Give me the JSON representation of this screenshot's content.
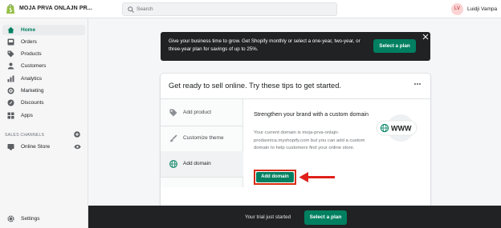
{
  "store": {
    "name": "MOJA PRVA ONLAJN PR..."
  },
  "search": {
    "placeholder": "Search"
  },
  "user": {
    "initials": "LV",
    "name": "Luidji Vampa"
  },
  "sidebar": {
    "items": [
      {
        "label": "Home",
        "icon": "home-icon"
      },
      {
        "label": "Orders",
        "icon": "orders-icon"
      },
      {
        "label": "Products",
        "icon": "tag-icon"
      },
      {
        "label": "Customers",
        "icon": "person-icon"
      },
      {
        "label": "Analytics",
        "icon": "bar-chart-icon"
      },
      {
        "label": "Marketing",
        "icon": "target-icon"
      },
      {
        "label": "Discounts",
        "icon": "discount-icon"
      },
      {
        "label": "Apps",
        "icon": "apps-icon"
      }
    ],
    "sales_channels_title": "SALES CHANNELS",
    "online_store_label": "Online Store",
    "settings_label": "Settings"
  },
  "banner": {
    "text": "Give your business time to grow. Get Shopify monthly or select a one-year, two-year, or three-year plan for savings of up to 25%.",
    "button_label": "Select a plan"
  },
  "card": {
    "title": "Get ready to sell online. Try these tips to get started.",
    "tips": [
      {
        "label": "Add product",
        "icon": "tag-icon"
      },
      {
        "label": "Customize theme",
        "icon": "brush-icon"
      },
      {
        "label": "Add domain",
        "icon": "globe-icon"
      }
    ],
    "detail": {
      "title": "Strengthen your brand with a custom domain",
      "body": "Your current domain is moja-prva-onlajn-prodavnica.myshopify.com but you can add a custom domain to help customers find your online store.",
      "button_label": "Add domain",
      "illustration_text": "WWW"
    }
  },
  "trial": {
    "text": "Your trial just started",
    "button_label": "Select a plan"
  },
  "colors": {
    "accent": "#008060",
    "highlight": "#d82c0d",
    "dark": "#202223"
  }
}
